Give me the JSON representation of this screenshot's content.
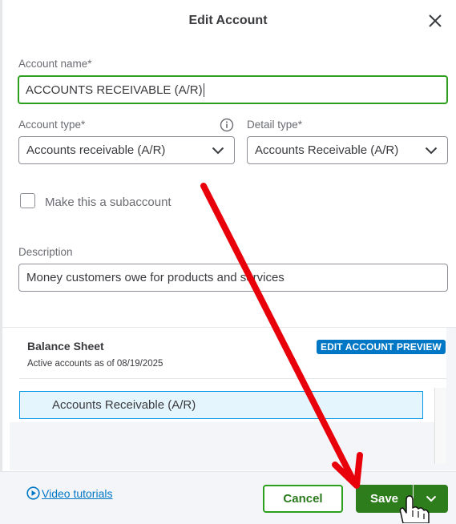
{
  "dialog": {
    "title": "Edit Account"
  },
  "form": {
    "account_name_label": "Account name*",
    "account_name_value": "ACCOUNTS RECEIVABLE (A/R)",
    "account_type_label": "Account type*",
    "account_type_value": "Accounts receivable (A/R)",
    "detail_type_label": "Detail type*",
    "detail_type_value": "Accounts Receivable (A/R)",
    "subaccount_label": "Make this a subaccount",
    "subaccount_checked": false,
    "description_label": "Description",
    "description_value": "Money customers owe for products and services"
  },
  "preview": {
    "section_title": "Balance Sheet",
    "subtitle": "Active accounts as of 08/19/2025",
    "badge": "EDIT ACCOUNT PREVIEW",
    "rows": [
      "Accounts Receivable (A/R)"
    ]
  },
  "footer": {
    "video_link": "Video tutorials",
    "cancel_label": "Cancel",
    "save_label": "Save"
  },
  "colors": {
    "accent_green": "#2ca01c",
    "save_green": "#2e7d1c",
    "badge_blue": "#0077c5",
    "annotation_red": "#e8000b"
  },
  "icons": [
    "close-icon",
    "info-icon",
    "chevron-down-icon",
    "play-circle-icon",
    "hand-cursor-icon"
  ]
}
